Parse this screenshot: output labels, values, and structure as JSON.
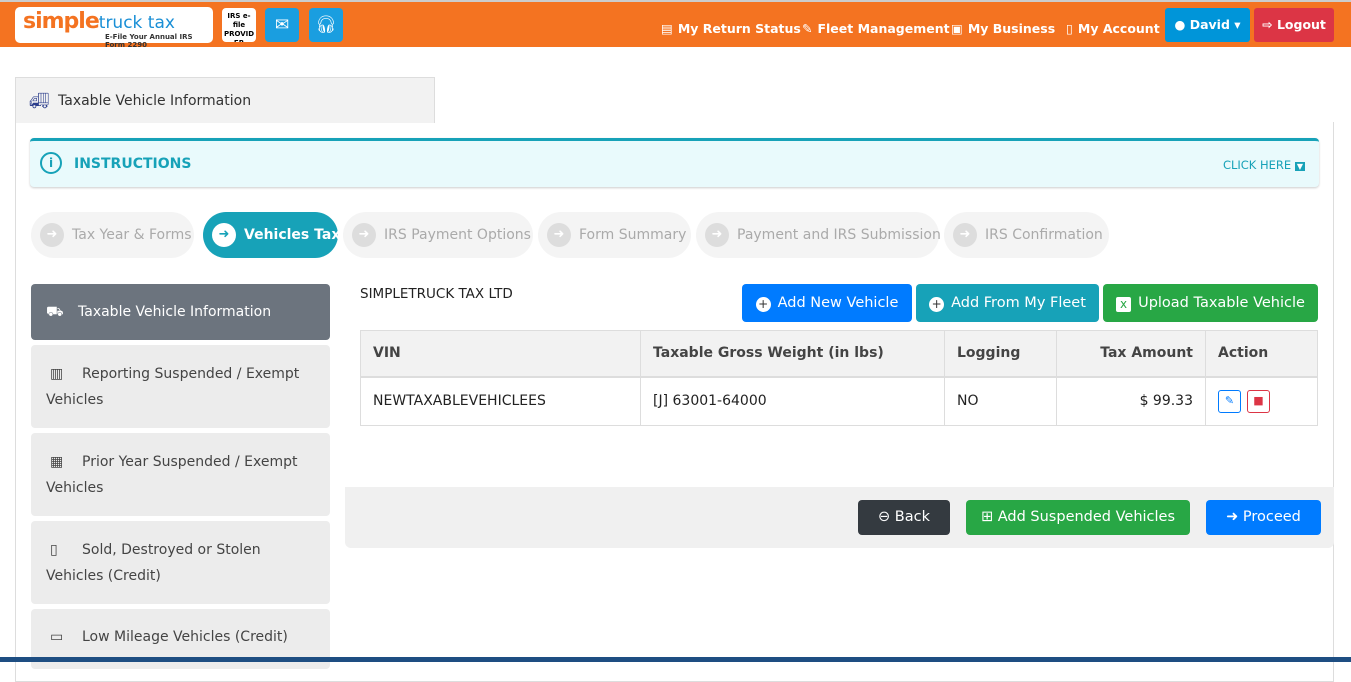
{
  "header": {
    "logo_text": "simple truck tax",
    "logo_tagline": "E-File Your Annual IRS Form 2290",
    "irs_badge": "IRS e-file PROVIDER",
    "nav": [
      {
        "label": "My Return Status",
        "icon": "document-icon"
      },
      {
        "label": "Fleet Management",
        "icon": "edit-icon"
      },
      {
        "label": "My Business",
        "icon": "briefcase-icon"
      },
      {
        "label": "My Account",
        "icon": "user-file-icon"
      }
    ],
    "user": "David",
    "logout": "Logout"
  },
  "tab": {
    "label": "Taxable Vehicle Information"
  },
  "instructions": {
    "title": "INSTRUCTIONS",
    "toggle": "CLICK HERE"
  },
  "steps": [
    {
      "label": "Tax Year & Forms"
    },
    {
      "label": "Vehicles Tax",
      "active": true
    },
    {
      "label": "IRS Payment Options"
    },
    {
      "label": "Form Summary"
    },
    {
      "label": "Payment and IRS Submission"
    },
    {
      "label": "IRS Confirmation"
    }
  ],
  "sidebar": [
    {
      "label": "Taxable Vehicle Information",
      "active": true
    },
    {
      "label": "Reporting Suspended / Exempt Vehicles"
    },
    {
      "label": "Prior Year Suspended / Exempt Vehicles"
    },
    {
      "label": "Sold, Destroyed or Stolen Vehicles (Credit)"
    },
    {
      "label": "Low Mileage Vehicles (Credit)"
    }
  ],
  "main": {
    "company": "SIMPLETRUCK TAX LTD",
    "add_new": "Add New Vehicle",
    "add_fleet": "Add From My Fleet",
    "upload": "Upload Taxable Vehicle",
    "columns": [
      "VIN",
      "Taxable Gross Weight (in lbs)",
      "Logging",
      "Tax Amount",
      "Action"
    ],
    "rows": [
      {
        "vin": "NEWTAXABLEVEHICLEES",
        "weight": "[J] 63001-64000",
        "logging": "NO",
        "tax": "$ 99.33"
      }
    ]
  },
  "footer": {
    "back": "Back",
    "add_suspended": "Add Suspended Vehicles",
    "proceed": "Proceed"
  },
  "colors": {
    "brand": "#f47321",
    "teal": "#17a2b8",
    "blue": "#007bff",
    "green": "#28a745",
    "red": "#dc3545"
  }
}
